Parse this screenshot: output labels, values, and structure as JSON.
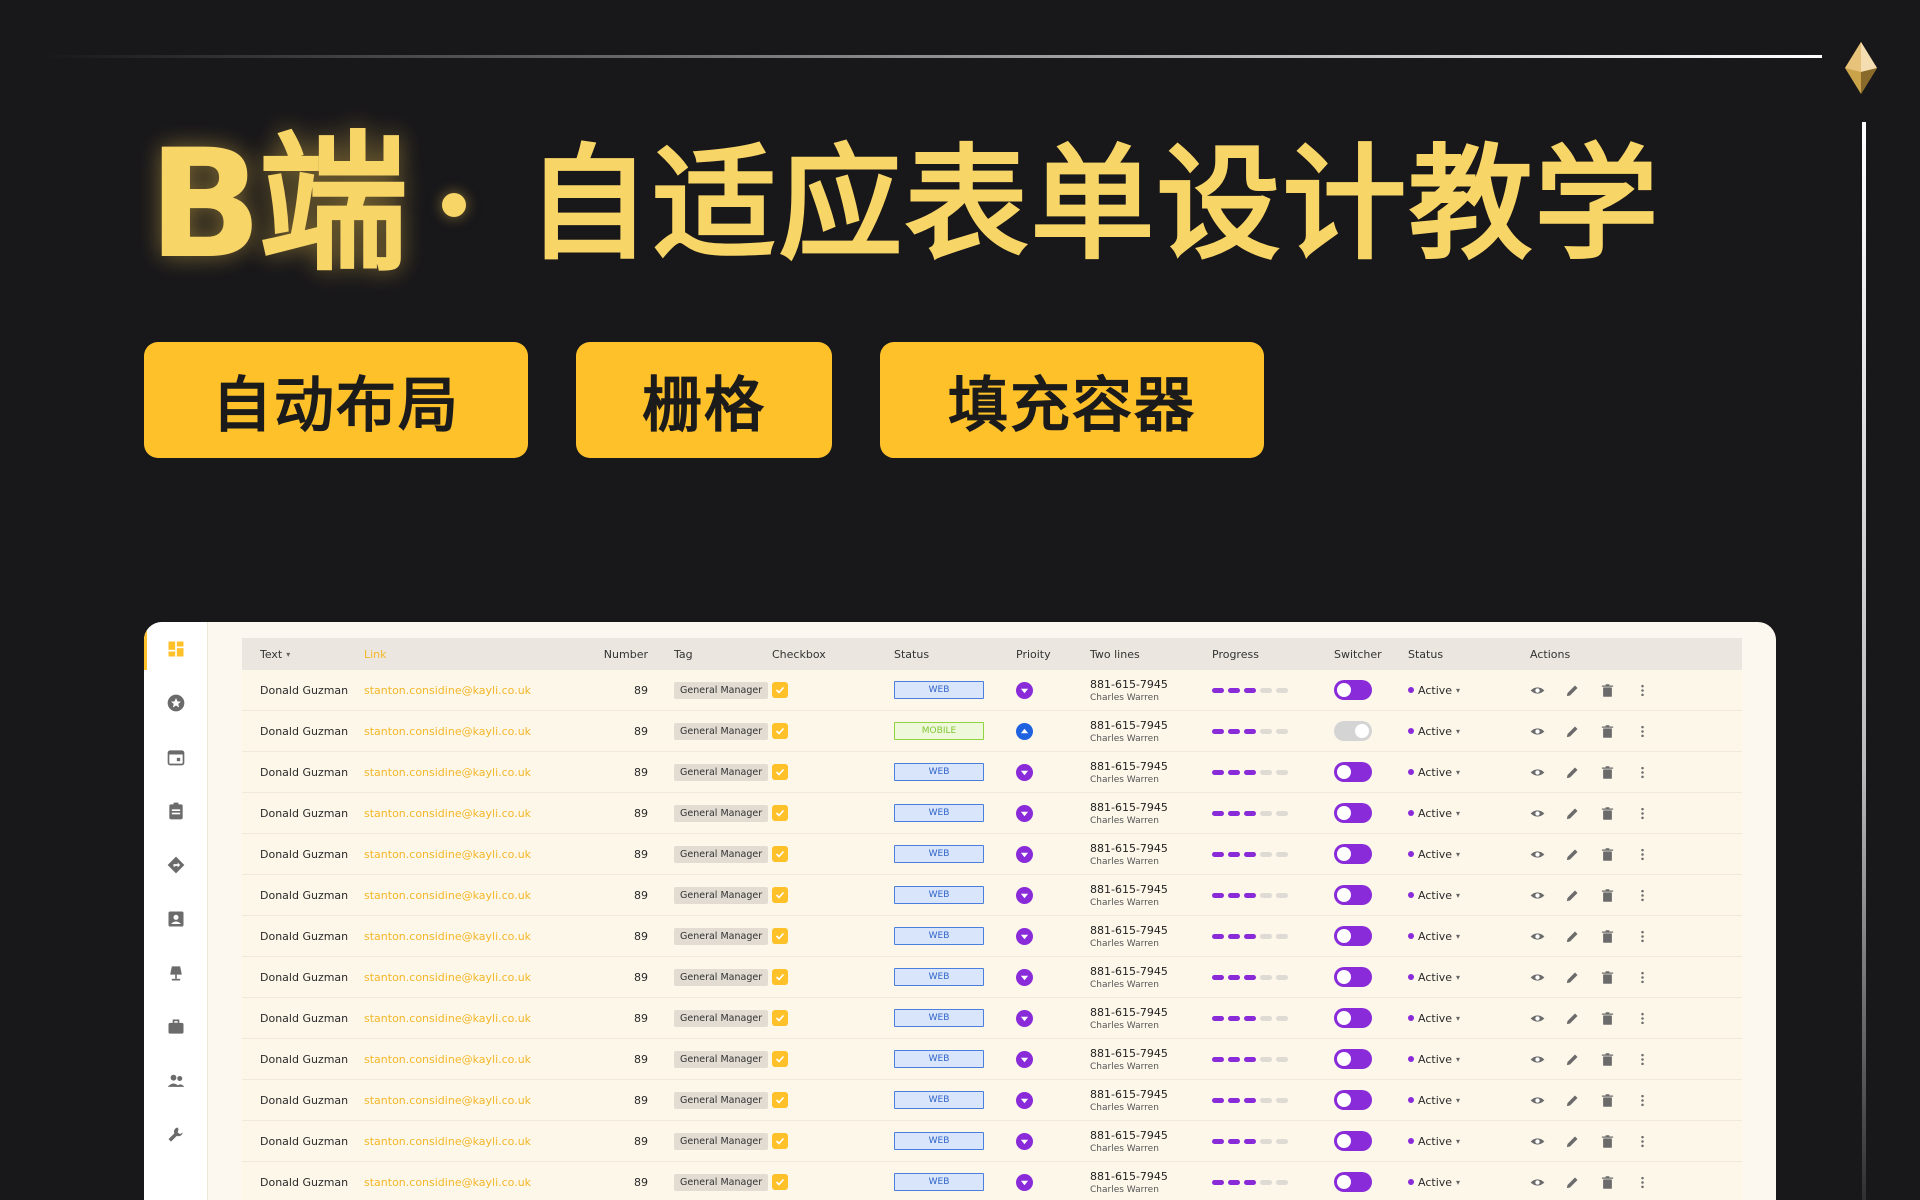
{
  "headline": {
    "big": "B端",
    "sub": "自适应表单设计教学"
  },
  "pills": [
    "自动布局",
    "栅格",
    "填充容器"
  ],
  "colors": {
    "accent": "#ffc12a",
    "title": "#f8d567",
    "purple": "#8a2bd9",
    "background": "#18171a"
  },
  "sidebar": {
    "icons": [
      "dashboard-icon",
      "star-icon",
      "calendar-icon",
      "clipboard-icon",
      "directions-icon",
      "contact-icon",
      "lamp-icon",
      "briefcase-icon",
      "people-icon",
      "wrench-icon"
    ]
  },
  "table": {
    "headers": [
      "Text",
      "Link",
      "Number",
      "Tag",
      "Checkbox",
      "Status",
      "Prioity",
      "Two lines",
      "Progress",
      "Switcher",
      "Status",
      "Actions"
    ],
    "sort_caret": "▾",
    "rows": [
      {
        "text": "Donald Guzman",
        "link": "stanton.considine@kayli.co.uk",
        "number": "89",
        "tag": "General Manager",
        "status": "WEB",
        "priority": "down",
        "line1": "881-615-7945",
        "line2": "Charles Warren",
        "progress": 3,
        "switch": true,
        "state": "Active"
      },
      {
        "text": "Donald Guzman",
        "link": "stanton.considine@kayli.co.uk",
        "number": "89",
        "tag": "General Manager",
        "status": "MOBILE",
        "priority": "up",
        "line1": "881-615-7945",
        "line2": "Charles Warren",
        "progress": 3,
        "switch": false,
        "state": "Active"
      },
      {
        "text": "Donald Guzman",
        "link": "stanton.considine@kayli.co.uk",
        "number": "89",
        "tag": "General Manager",
        "status": "WEB",
        "priority": "down",
        "line1": "881-615-7945",
        "line2": "Charles Warren",
        "progress": 3,
        "switch": true,
        "state": "Active"
      },
      {
        "text": "Donald Guzman",
        "link": "stanton.considine@kayli.co.uk",
        "number": "89",
        "tag": "General Manager",
        "status": "WEB",
        "priority": "down",
        "line1": "881-615-7945",
        "line2": "Charles Warren",
        "progress": 3,
        "switch": true,
        "state": "Active"
      },
      {
        "text": "Donald Guzman",
        "link": "stanton.considine@kayli.co.uk",
        "number": "89",
        "tag": "General Manager",
        "status": "WEB",
        "priority": "down",
        "line1": "881-615-7945",
        "line2": "Charles Warren",
        "progress": 3,
        "switch": true,
        "state": "Active"
      },
      {
        "text": "Donald Guzman",
        "link": "stanton.considine@kayli.co.uk",
        "number": "89",
        "tag": "General Manager",
        "status": "WEB",
        "priority": "down",
        "line1": "881-615-7945",
        "line2": "Charles Warren",
        "progress": 3,
        "switch": true,
        "state": "Active"
      },
      {
        "text": "Donald Guzman",
        "link": "stanton.considine@kayli.co.uk",
        "number": "89",
        "tag": "General Manager",
        "status": "WEB",
        "priority": "down",
        "line1": "881-615-7945",
        "line2": "Charles Warren",
        "progress": 3,
        "switch": true,
        "state": "Active"
      },
      {
        "text": "Donald Guzman",
        "link": "stanton.considine@kayli.co.uk",
        "number": "89",
        "tag": "General Manager",
        "status": "WEB",
        "priority": "down",
        "line1": "881-615-7945",
        "line2": "Charles Warren",
        "progress": 3,
        "switch": true,
        "state": "Active"
      },
      {
        "text": "Donald Guzman",
        "link": "stanton.considine@kayli.co.uk",
        "number": "89",
        "tag": "General Manager",
        "status": "WEB",
        "priority": "down",
        "line1": "881-615-7945",
        "line2": "Charles Warren",
        "progress": 3,
        "switch": true,
        "state": "Active"
      },
      {
        "text": "Donald Guzman",
        "link": "stanton.considine@kayli.co.uk",
        "number": "89",
        "tag": "General Manager",
        "status": "WEB",
        "priority": "down",
        "line1": "881-615-7945",
        "line2": "Charles Warren",
        "progress": 3,
        "switch": true,
        "state": "Active"
      },
      {
        "text": "Donald Guzman",
        "link": "stanton.considine@kayli.co.uk",
        "number": "89",
        "tag": "General Manager",
        "status": "WEB",
        "priority": "down",
        "line1": "881-615-7945",
        "line2": "Charles Warren",
        "progress": 3,
        "switch": true,
        "state": "Active"
      },
      {
        "text": "Donald Guzman",
        "link": "stanton.considine@kayli.co.uk",
        "number": "89",
        "tag": "General Manager",
        "status": "WEB",
        "priority": "down",
        "line1": "881-615-7945",
        "line2": "Charles Warren",
        "progress": 3,
        "switch": true,
        "state": "Active"
      },
      {
        "text": "Donald Guzman",
        "link": "stanton.considine@kayli.co.uk",
        "number": "89",
        "tag": "General Manager",
        "status": "WEB",
        "priority": "down",
        "line1": "881-615-7945",
        "line2": "Charles Warren",
        "progress": 3,
        "switch": true,
        "state": "Active"
      }
    ]
  }
}
